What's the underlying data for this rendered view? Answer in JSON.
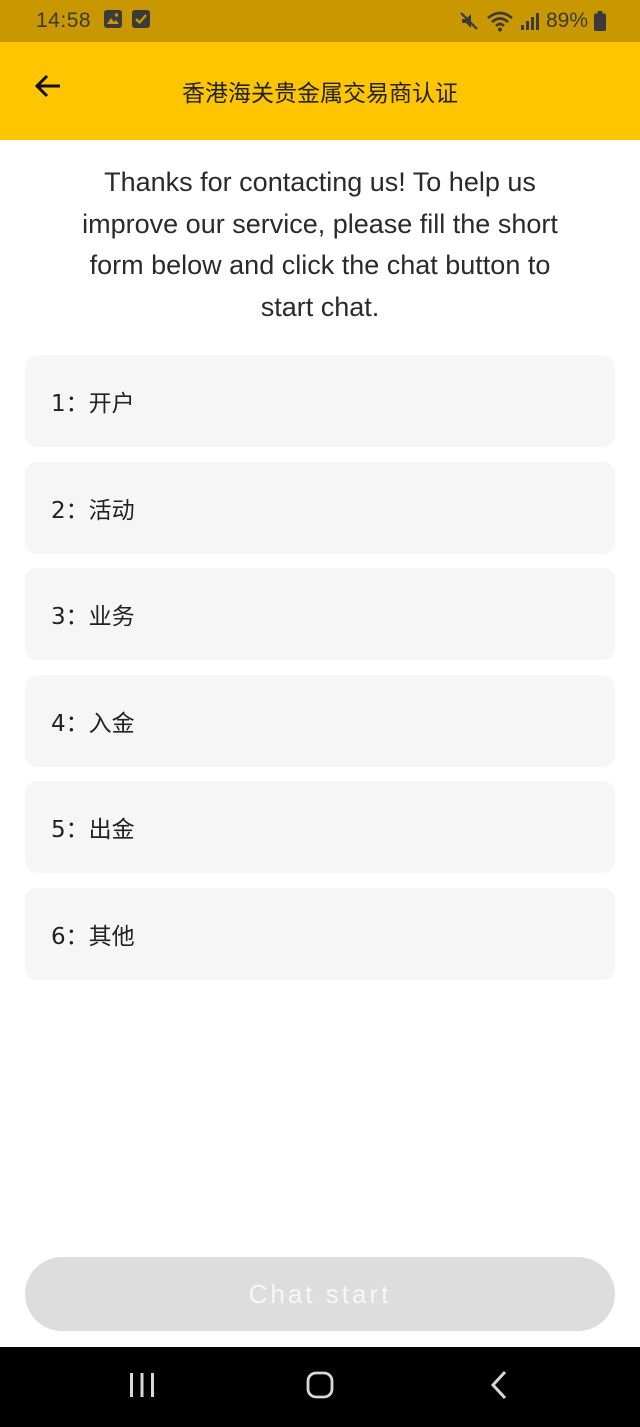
{
  "status_bar": {
    "time": "14:58",
    "battery": "89%"
  },
  "app_bar": {
    "title": "香港海关贵金属交易商认证"
  },
  "intro": {
    "text": "Thanks for contacting us! To help us improve our service, please fill the short form below and click the chat button to start chat."
  },
  "options": [
    {
      "label": "1：开户"
    },
    {
      "label": "2：活动"
    },
    {
      "label": "3：业务"
    },
    {
      "label": "4：入金"
    },
    {
      "label": "5：出金"
    },
    {
      "label": "6：其他"
    }
  ],
  "chat_button": {
    "label": "Chat start"
  },
  "icons": {
    "back": "arrow-left-icon",
    "mute": "mute-icon",
    "wifi": "wifi-icon",
    "signal": "signal-icon",
    "battery": "battery-icon",
    "nav_recents": "recents-icon",
    "nav_home": "home-icon",
    "nav_back": "chevron-left-icon"
  },
  "colors": {
    "status_bar": "#c99700",
    "app_bar": "#ffc500",
    "option_bg": "#f6f6f6",
    "button_disabled": "#dddddd"
  }
}
